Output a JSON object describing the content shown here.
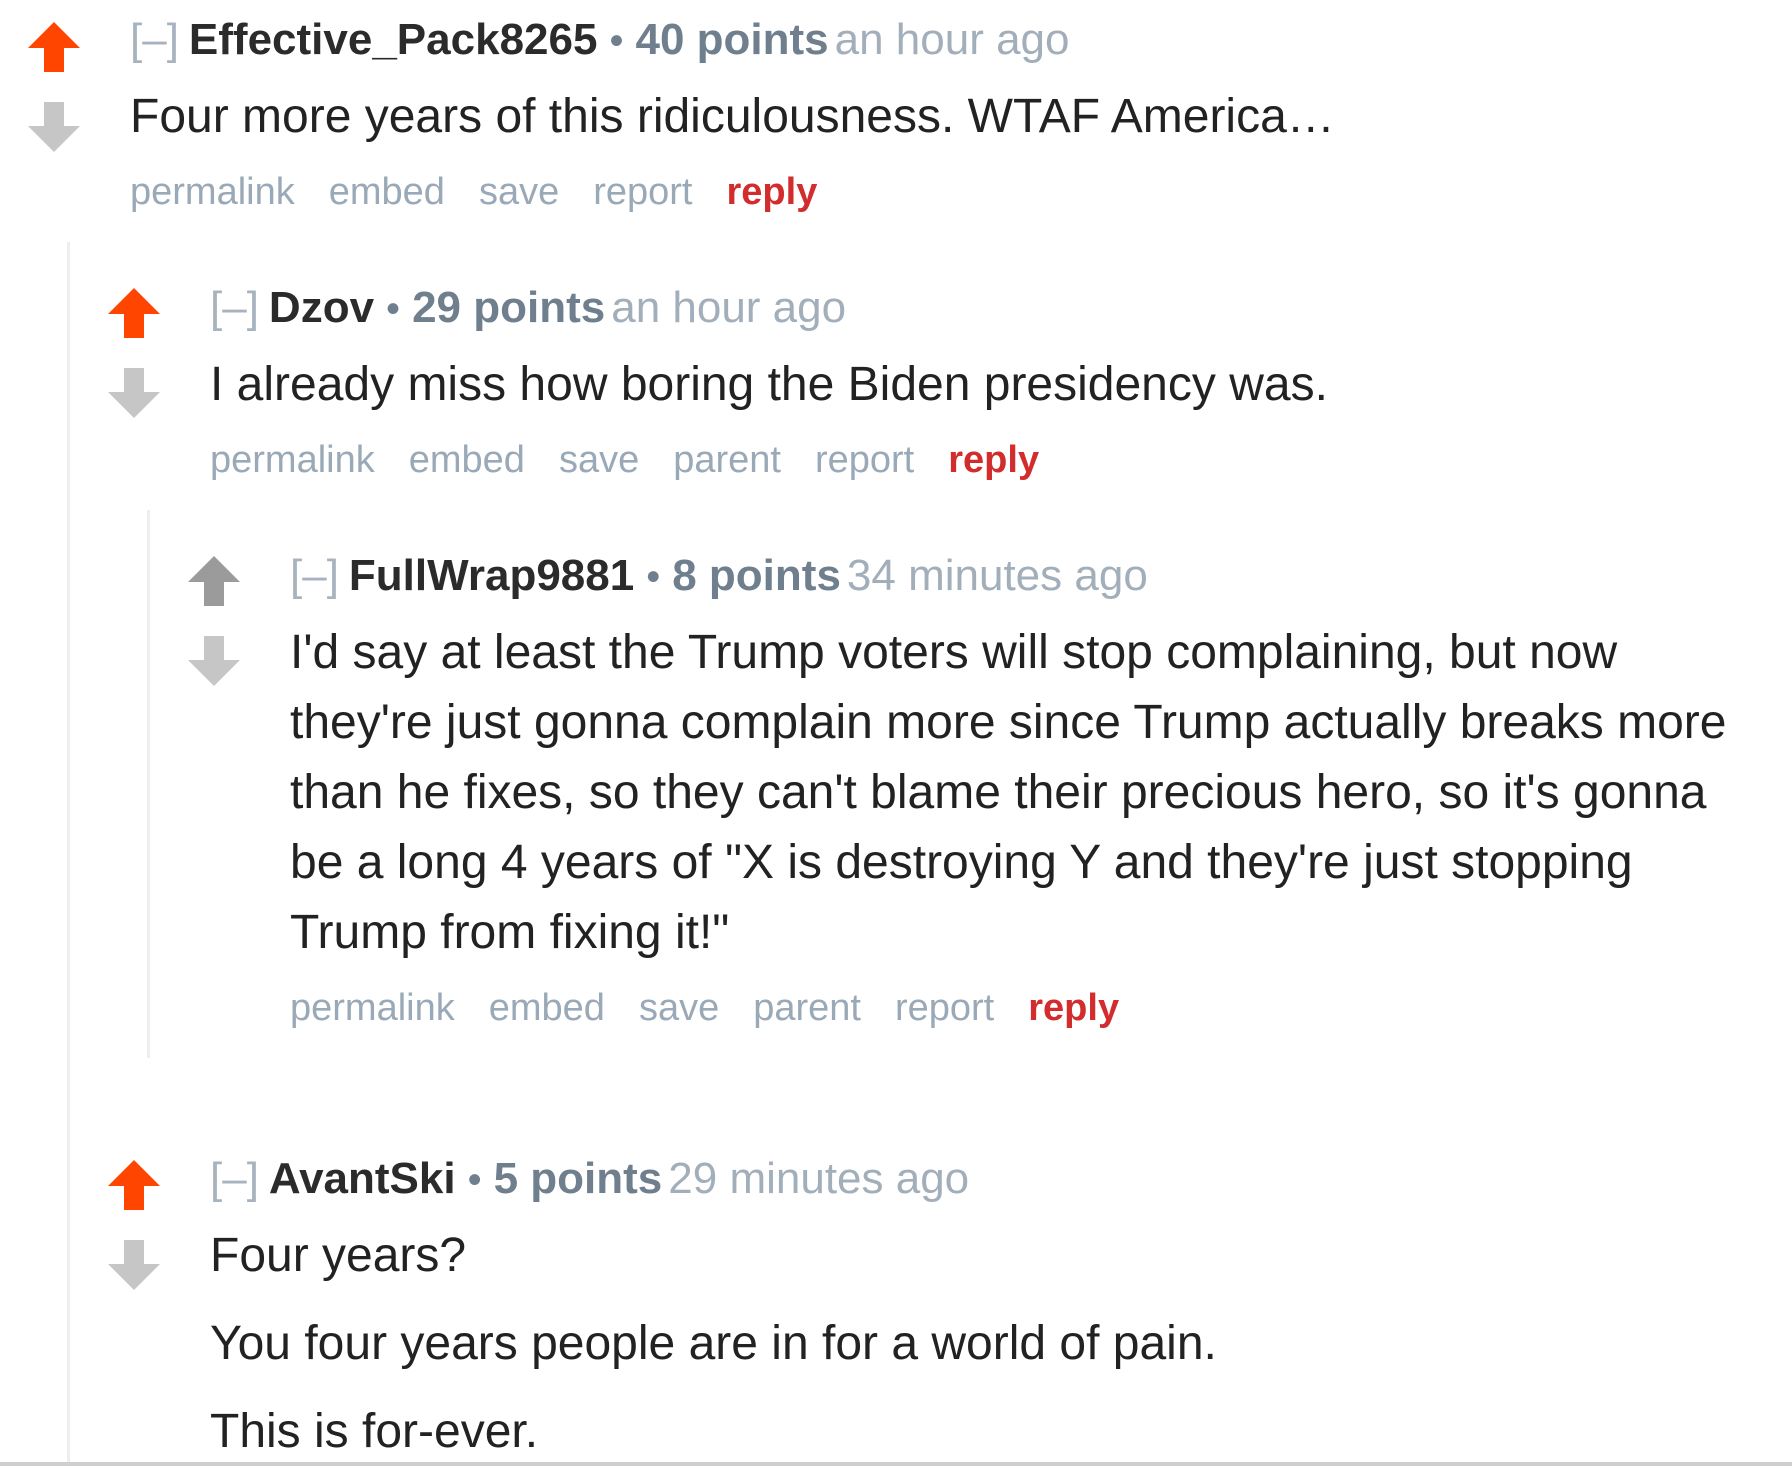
{
  "colors": {
    "upvote_active": "#ff4500",
    "vote_inactive": "#c6c6c6",
    "upvote_neutral": "#9b9b9b",
    "reply_link": "#d22c2c",
    "meta_link": "#9aa9b7"
  },
  "comments": [
    {
      "expand": "[–]",
      "author": "Effective_Pack8265",
      "separator": "•",
      "score": "40 points",
      "time": "an hour ago",
      "body": [
        "Four more years of this ridiculousness. WTAF America…"
      ],
      "upvote_state": "active",
      "buttons": {
        "permalink": "permalink",
        "embed": "embed",
        "save": "save",
        "report": "report",
        "reply": "reply"
      }
    },
    {
      "expand": "[–]",
      "author": "Dzov",
      "separator": "•",
      "score": "29 points",
      "time": "an hour ago",
      "body": [
        "I already miss how boring the Biden presidency was."
      ],
      "upvote_state": "active",
      "buttons": {
        "permalink": "permalink",
        "embed": "embed",
        "save": "save",
        "parent": "parent",
        "report": "report",
        "reply": "reply"
      }
    },
    {
      "expand": "[–]",
      "author": "FullWrap9881",
      "separator": "•",
      "score": "8 points",
      "time": "34 minutes ago",
      "body": [
        "I'd say at least the Trump voters will stop complaining, but now they're just gonna complain more since Trump actually breaks more than he fixes, so they can't blame their precious hero, so it's gonna be a long 4 years of \"X is destroying Y and they're just stopping Trump from fixing it!\""
      ],
      "upvote_state": "neutral",
      "buttons": {
        "permalink": "permalink",
        "embed": "embed",
        "save": "save",
        "parent": "parent",
        "report": "report",
        "reply": "reply"
      }
    },
    {
      "expand": "[–]",
      "author": "AvantSki",
      "separator": "•",
      "score": "5 points",
      "time": "29 minutes ago",
      "body": [
        "Four years?",
        "You four years people are in for a world of pain.",
        "This is for-ever."
      ],
      "upvote_state": "active"
    }
  ]
}
